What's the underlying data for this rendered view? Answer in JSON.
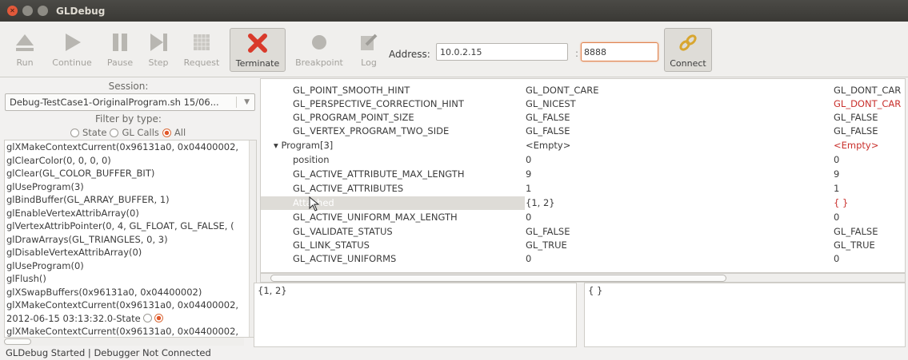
{
  "window": {
    "title": "GLDebug"
  },
  "toolbar": {
    "run": "Run",
    "continue": "Continue",
    "pause": "Pause",
    "step": "Step",
    "request": "Request",
    "terminate": "Terminate",
    "breakpoint": "Breakpoint",
    "log": "Log",
    "connect": "Connect",
    "address_label": "Address:",
    "address_value": "10.0.2.15",
    "port_separator": ":",
    "port_value": "8888"
  },
  "left": {
    "session_label": "Session:",
    "session_value": "Debug-TestCase1-OriginalProgram.sh 15/06...",
    "filter_label": "Filter by type:",
    "filter_options": [
      "State",
      "GL Calls",
      "All"
    ],
    "filter_selected": "All",
    "calls": [
      "glXMakeContextCurrent(0x96131a0, 0x04400002,",
      "glClearColor(0, 0, 0, 0)",
      "glClear(GL_COLOR_BUFFER_BIT)",
      "glUseProgram(3)",
      "glBindBuffer(GL_ARRAY_BUFFER, 1)",
      "glEnableVertexAttribArray(0)",
      "glVertexAttribPointer(0, 4, GL_FLOAT, GL_FALSE, (",
      "glDrawArrays(GL_TRIANGLES, 0, 3)",
      "glDisableVertexAttribArray(0)",
      "glUseProgram(0)",
      "glFlush()",
      "glXSwapBuffers(0x96131a0, 0x04400002)",
      "glXMakeContextCurrent(0x96131a0, 0x04400002,",
      "2012-06-15 03:13:32.0-State",
      "glXMakeContextCurrent(0x96131a0, 0x04400002,"
    ]
  },
  "tree": {
    "rows": [
      {
        "name": "GL_POINT_SMOOTH_HINT",
        "value": "GL_DONT_CARE",
        "value2": "GL_DONT_CAR",
        "changed": false
      },
      {
        "name": "GL_PERSPECTIVE_CORRECTION_HINT",
        "value": "GL_NICEST",
        "value2": "GL_DONT_CAR",
        "changed": true
      },
      {
        "name": "GL_PROGRAM_POINT_SIZE",
        "value": "GL_FALSE",
        "value2": "GL_FALSE",
        "changed": false
      },
      {
        "name": "GL_VERTEX_PROGRAM_TWO_SIDE",
        "value": "GL_FALSE",
        "value2": "GL_FALSE",
        "changed": false
      },
      {
        "name": "Program[3]",
        "value": "<Empty>",
        "value2": "<Empty>",
        "changed": true,
        "expander": true
      },
      {
        "name": "position",
        "value": "0",
        "value2": "0",
        "changed": false
      },
      {
        "name": "GL_ACTIVE_ATTRIBUTE_MAX_LENGTH",
        "value": "9",
        "value2": "9",
        "changed": false
      },
      {
        "name": "GL_ACTIVE_ATTRIBUTES",
        "value": "1",
        "value2": "1",
        "changed": false
      },
      {
        "name": "Attached",
        "value": "{1, 2}",
        "value2": "{ }",
        "changed": true,
        "selected": true
      },
      {
        "name": "GL_ACTIVE_UNIFORM_MAX_LENGTH",
        "value": "0",
        "value2": "0",
        "changed": false
      },
      {
        "name": "GL_VALIDATE_STATUS",
        "value": "GL_FALSE",
        "value2": "GL_FALSE",
        "changed": false
      },
      {
        "name": "GL_LINK_STATUS",
        "value": "GL_TRUE",
        "value2": "GL_TRUE",
        "changed": false
      },
      {
        "name": "GL_ACTIVE_UNIFORMS",
        "value": "0",
        "value2": "0",
        "changed": false
      }
    ]
  },
  "panes": {
    "left_text": "{1, 2}",
    "right_text": "{ }"
  },
  "status": {
    "text": "GLDebug Started | Debugger Not Connected"
  },
  "colors": {
    "changed_value": "#c9302c",
    "accent_radio": "#e2592c",
    "terminate_red": "#d93a2b",
    "connect_gold": "#d8a630"
  }
}
